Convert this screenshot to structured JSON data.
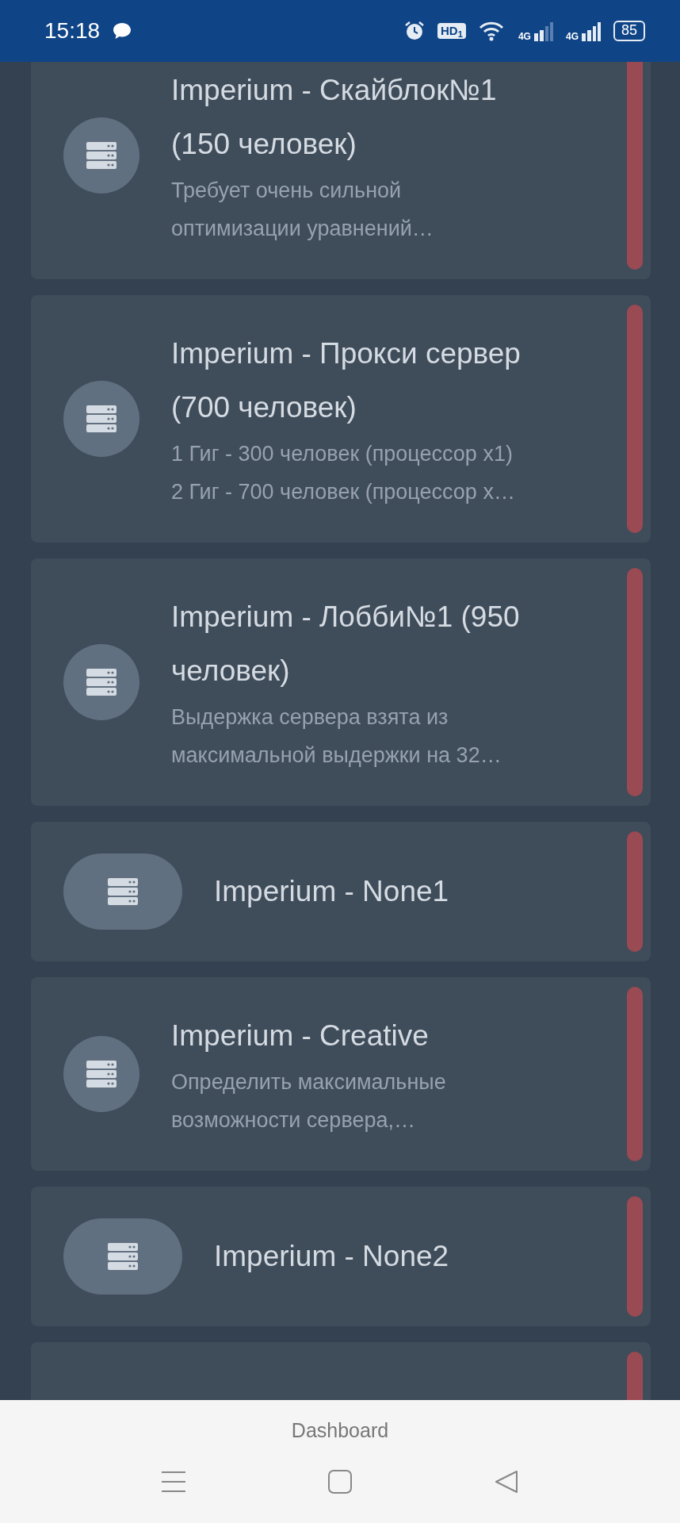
{
  "status_bar": {
    "time": "15:18",
    "hd_badge": "HD$_{1}$",
    "network_labels": [
      "4G",
      "4G"
    ],
    "battery": "85"
  },
  "servers": [
    {
      "kind": "detailed",
      "title": "Imperium - Скайблок№1\n(150 человек)",
      "description": "Требует очень сильной\nоптимизации уравнений…"
    },
    {
      "kind": "detailed",
      "title": "Imperium - Прокси сервер\n(700 человек)",
      "description": "1 Гиг - 300 человек (процессор x1)\n2 Гиг - 700 человек (процессор x…"
    },
    {
      "kind": "detailed",
      "title": "Imperium - Лобби№1 (950\nчеловек)",
      "description": "Выдержка сервера взята из\nмаксимальной выдержки на 32…"
    },
    {
      "kind": "simple",
      "title": "Imperium - None1"
    },
    {
      "kind": "detailed",
      "title": "Imperium - Creative",
      "description": "Определить максимальные\nвозможности сервера,…"
    },
    {
      "kind": "simple",
      "title": "Imperium - None2"
    }
  ],
  "more_below": true,
  "bottom_tab": {
    "label": "Dashboard"
  }
}
